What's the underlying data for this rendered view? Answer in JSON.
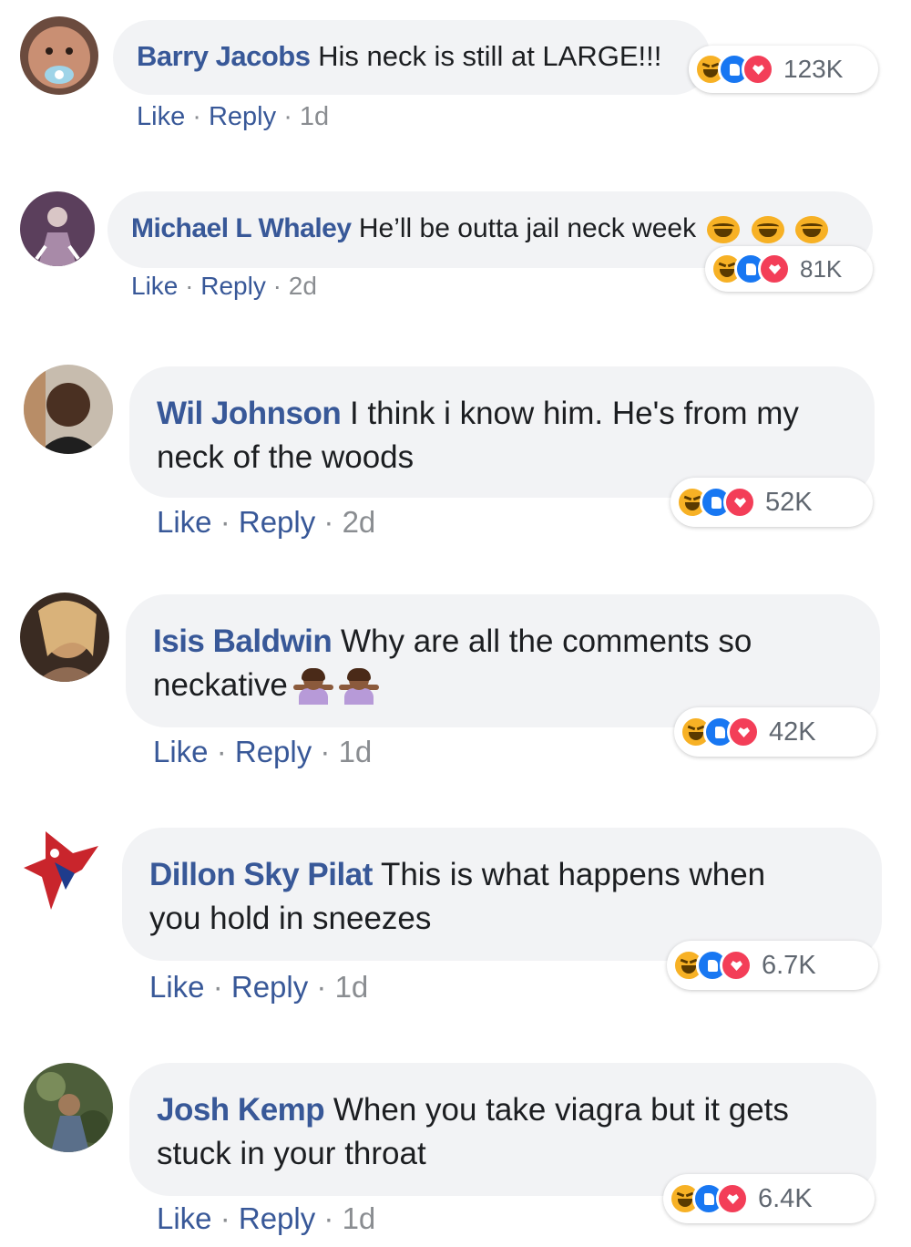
{
  "comments": [
    {
      "author": "Barry Jacobs",
      "text": "His neck is still at LARGE!!!",
      "actions": {
        "like": "Like",
        "reply": "Reply",
        "age": "1d"
      },
      "reaction_count": "123K",
      "reactions": [
        "haha",
        "like",
        "love"
      ]
    },
    {
      "author": "Michael L Whaley",
      "text": "He’ll be outta jail neck week",
      "inline_emoji": [
        "laughing-crying",
        "laughing-crying",
        "laughing-crying"
      ],
      "actions": {
        "like": "Like",
        "reply": "Reply",
        "age": "2d"
      },
      "reaction_count": "81K",
      "reactions": [
        "haha",
        "like",
        "love"
      ]
    },
    {
      "author": "Wil Johnson",
      "text_line1": "I think i know him. He's from my",
      "text_line2": "neck of the woods",
      "actions": {
        "like": "Like",
        "reply": "Reply",
        "age": "2d"
      },
      "reaction_count": "52K",
      "reactions": [
        "haha",
        "like",
        "love"
      ]
    },
    {
      "author": "Isis Baldwin",
      "text_line1": "Why are all the comments so",
      "text_line2": "neckative",
      "inline_emoji": [
        "person-shrugging",
        "person-shrugging"
      ],
      "actions": {
        "like": "Like",
        "reply": "Reply",
        "age": "1d"
      },
      "reaction_count": "42K",
      "reactions": [
        "haha",
        "like",
        "love"
      ]
    },
    {
      "author": "Dillon Sky Pilat",
      "text_line1": "This is what happens when",
      "text_line2": "you hold in sneezes",
      "actions": {
        "like": "Like",
        "reply": "Reply",
        "age": "1d"
      },
      "reaction_count": "6.7K",
      "reactions": [
        "haha",
        "like",
        "love"
      ]
    },
    {
      "author": "Josh Kemp",
      "text_line1": "When you take viagra but it gets",
      "text_line2": "stuck in your throat",
      "actions": {
        "like": "Like",
        "reply": "Reply",
        "age": "1d"
      },
      "reaction_count": "6.4K",
      "reactions": [
        "haha",
        "like",
        "love"
      ]
    }
  ],
  "colors": {
    "author": "#385898",
    "bubble": "#f2f3f5",
    "haha": "#f7b125",
    "like": "#1877f2",
    "love": "#f33e58"
  }
}
